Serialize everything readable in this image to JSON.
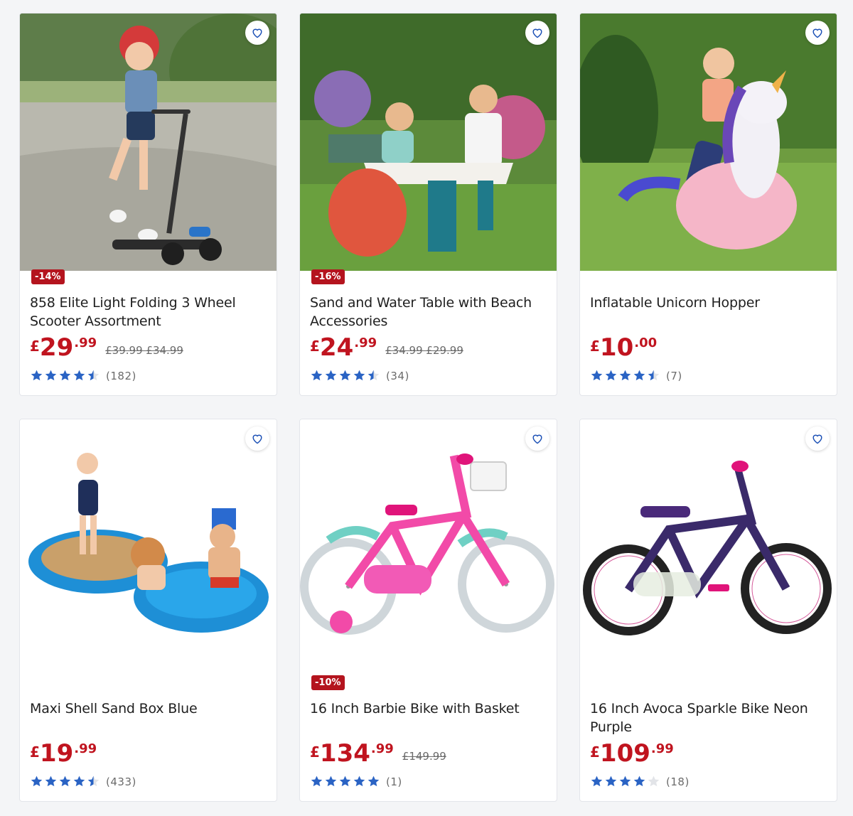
{
  "products": [
    {
      "title": "858 Elite Light Folding 3 Wheel Scooter Assortment",
      "badge": "-14%",
      "price_currency": "£",
      "price_whole": "29",
      "price_frac": ".99",
      "was_prices": "£39.99 £34.99",
      "rating": 4.5,
      "review_count": "(182)"
    },
    {
      "title": "Sand and Water Table with Beach Accessories",
      "badge": "-16%",
      "price_currency": "£",
      "price_whole": "24",
      "price_frac": ".99",
      "was_prices": "£34.99 £29.99",
      "rating": 4.5,
      "review_count": "(34)"
    },
    {
      "title": "Inflatable Unicorn Hopper",
      "badge": "",
      "price_currency": "£",
      "price_whole": "10",
      "price_frac": ".00",
      "was_prices": "",
      "rating": 4.5,
      "review_count": "(7)"
    },
    {
      "title": "Maxi Shell Sand Box Blue",
      "badge": "",
      "price_currency": "£",
      "price_whole": "19",
      "price_frac": ".99",
      "was_prices": "",
      "rating": 4.5,
      "review_count": "(433)"
    },
    {
      "title": "16 Inch Barbie Bike with Basket",
      "badge": "-10%",
      "price_currency": "£",
      "price_whole": "134",
      "price_frac": ".99",
      "was_prices": "£149.99",
      "rating": 5,
      "review_count": "(1)"
    },
    {
      "title": "16 Inch Avoca Sparkle Bike Neon Purple",
      "badge": "",
      "price_currency": "£",
      "price_whole": "109",
      "price_frac": ".99",
      "was_prices": "",
      "rating": 4,
      "review_count": "(18)"
    }
  ],
  "icons": {
    "wishlist": "heart-icon",
    "star": "star-icon"
  },
  "colors": {
    "price": "#c0141f",
    "badge": "#b4141e",
    "star": "#2a63c4",
    "heart": "#1a4fb5"
  }
}
